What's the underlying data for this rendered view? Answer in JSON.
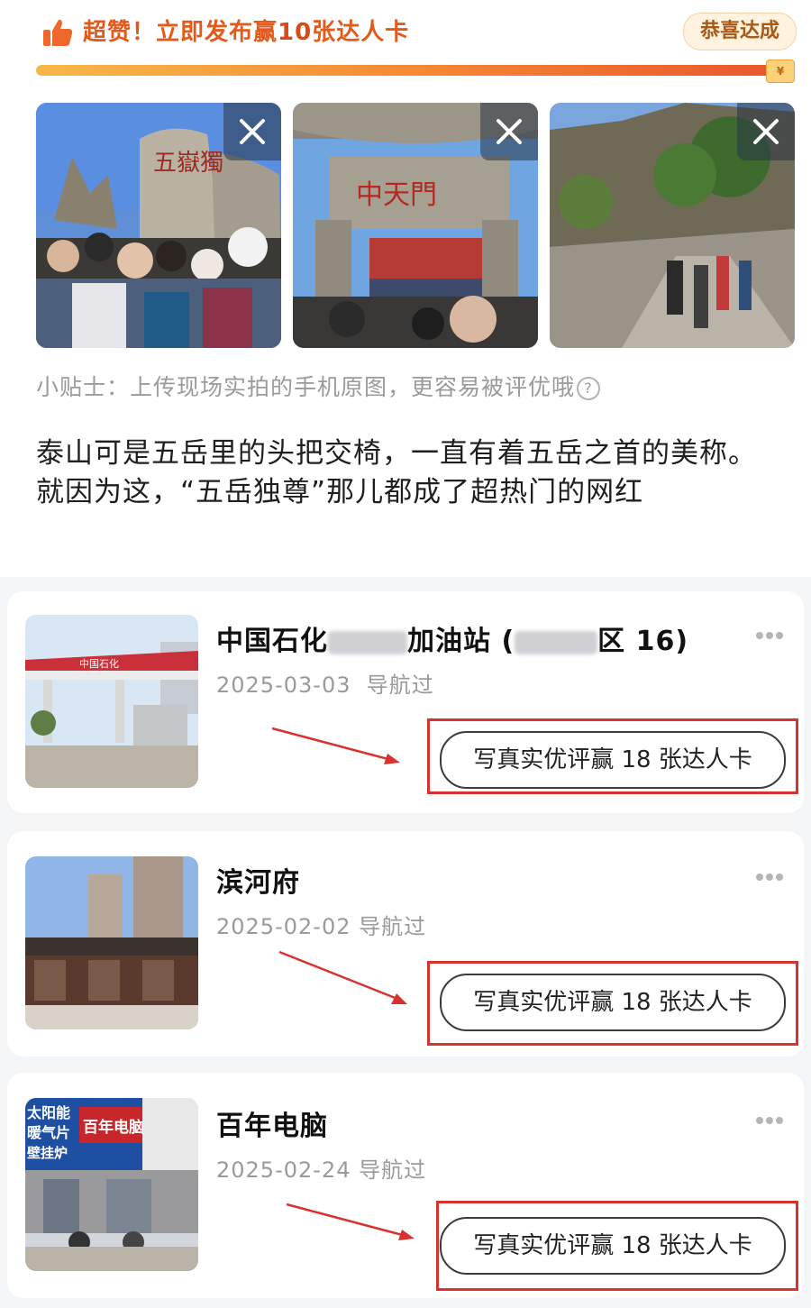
{
  "banner": {
    "prefix": "超赞！立即发布赢",
    "count": "10",
    "suffix": "张达人卡",
    "achieved_label": "恭喜达成",
    "progress_percent": 100,
    "reward_glyph": "¥"
  },
  "photos": [
    {
      "name": "photo-wuyue-rock",
      "close_icon": "close-icon"
    },
    {
      "name": "photo-zhongtianmen-gate",
      "close_icon": "close-icon"
    },
    {
      "name": "photo-mountain-stairs",
      "close_icon": "close-icon"
    }
  ],
  "tip": {
    "text": "小贴士：上传现场实拍的手机原图，更容易被评优哦",
    "help_glyph": "?"
  },
  "post": {
    "text": "泰山可是五岳里的头把交椅，一直有着五岳之首的美称。就因为这，“五岳独尊”那儿都成了超热门的网红"
  },
  "places": [
    {
      "title_start": "中国石化",
      "title_mid": "加油站 (",
      "title_end": "区 16)",
      "date": "2025-03-03",
      "status": "导航过",
      "cta": "写真实优评赢 18 张达人卡"
    },
    {
      "title_start": "滨河府",
      "date": "2025-02-02",
      "status": "导航过",
      "cta": "写真实优评赢 18 张达人卡"
    },
    {
      "title_start": "百年电脑",
      "date": "2025-02-24",
      "status": "导航过",
      "cta": "写真实优评赢 18 张达人卡"
    }
  ],
  "photo_signs": {
    "p1_sign": "五嶽獨",
    "p2_sign": "中天門",
    "gas_sign": "中国石化",
    "shop_sign_1": "太阳能",
    "shop_sign_2": "暖气片",
    "shop_sign_3": "百年电脑",
    "shop_sign_4": "壁挂炉"
  },
  "colors": {
    "accent": "#e35a1b",
    "annotation_red": "#d8322c",
    "progress_start": "#f7b74a",
    "progress_end": "#e9572c"
  }
}
